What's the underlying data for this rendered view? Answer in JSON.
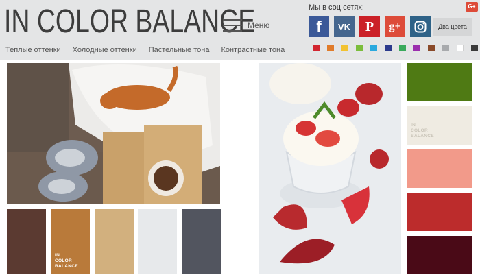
{
  "header": {
    "logo": "IN COLOR BALANCE",
    "menu_label": "Меню",
    "nav": [
      "Теплые оттенки",
      "Холодные оттенки",
      "Пастельные тона",
      "Контрастные тона"
    ],
    "social_title": "Мы в соц сетях:",
    "social": [
      {
        "name": "facebook",
        "icon": "facebook-icon",
        "glyph": "f",
        "color": "#3b5998"
      },
      {
        "name": "vkontakte",
        "icon": "vk-icon",
        "glyph": "VK",
        "color": "#45668e"
      },
      {
        "name": "pinterest",
        "icon": "pinterest-icon",
        "glyph": "P",
        "color": "#cb2027"
      },
      {
        "name": "google-plus",
        "icon": "google-plus-icon",
        "glyph": "g+",
        "color": "#dd4b39"
      },
      {
        "name": "instagram",
        "icon": "instagram-icon",
        "glyph": "",
        "color": "#2e6287"
      }
    ],
    "two_colors_label": "Два цвета",
    "gplus_badge": "G+",
    "color_filters": [
      "#d22630",
      "#e07b2a",
      "#f2c231",
      "#7bbd3c",
      "#2aa9de",
      "#2b3a8c",
      "#3aaa5c",
      "#9b2fae",
      "#8a4a2a",
      "#a8aaad",
      "#ffffff",
      "#3a3a3a"
    ]
  },
  "left_card": {
    "photo": "cat-on-fur-with-coffee-photo",
    "palette": [
      "#5b3a31",
      "#b97a3a",
      "#d2b07e",
      "#e7e9eb",
      "#52555f"
    ],
    "brand_mark": [
      "IN",
      "COLOR",
      "BALANCE"
    ]
  },
  "right_card": {
    "photo": "strawberries-ice-cream-photo",
    "palette": [
      "#4f7a14",
      "#efebe2",
      "#f29a8a",
      "#bc2c2c",
      "#4a0a17"
    ],
    "brand_mark": [
      "IN",
      "COLOR",
      "BALANCE"
    ]
  }
}
